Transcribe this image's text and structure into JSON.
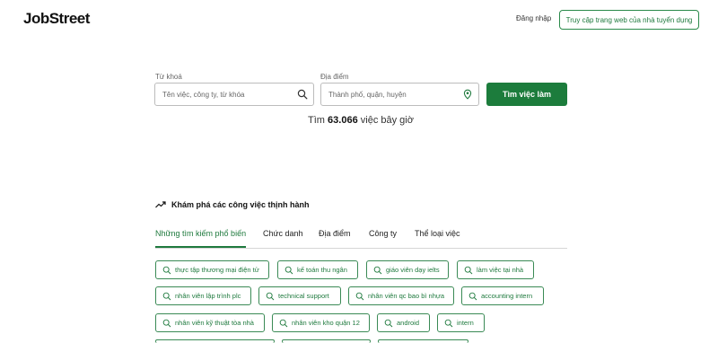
{
  "header": {
    "logo": "JobStreet",
    "login": "Đăng nhập",
    "employer_button": "Truy cập trang web của nhà tuyển dụng"
  },
  "search": {
    "keyword_label": "Từ khoá",
    "keyword_placeholder": "Tên việc, công ty, từ khóa",
    "location_label": "Địa điểm",
    "location_placeholder": "Thành phố, quận, huyện",
    "button": "Tìm việc làm",
    "count_prefix": "Tìm",
    "count_value": "63.066",
    "count_suffix": "việc bây giờ"
  },
  "explore": {
    "title": "Khám phá các công việc thịnh hành",
    "tabs": [
      "Những tìm kiếm phổ biến",
      "Chức danh",
      "Địa điểm",
      "Công ty",
      "Thể loại việc"
    ],
    "active_tab": 0,
    "chips": [
      "thực tập thương mại điện tử",
      "kế toán thu ngân",
      "giáo viên dạy ielts",
      "làm việc tại nhà",
      "nhân viên lập trình plc",
      "technical support",
      "nhân viên qc bao bì nhựa",
      "accounting intern",
      "nhân viên kỹ thuật tòa nhà",
      "nhân viên kho quận 12",
      "android",
      "intern",
      "",
      "",
      ""
    ]
  },
  "colors": {
    "brand_green": "#1c7c3c",
    "chip_border": "#3a8a55"
  },
  "icons": [
    "search-icon",
    "location-pin-icon",
    "trending-icon"
  ]
}
